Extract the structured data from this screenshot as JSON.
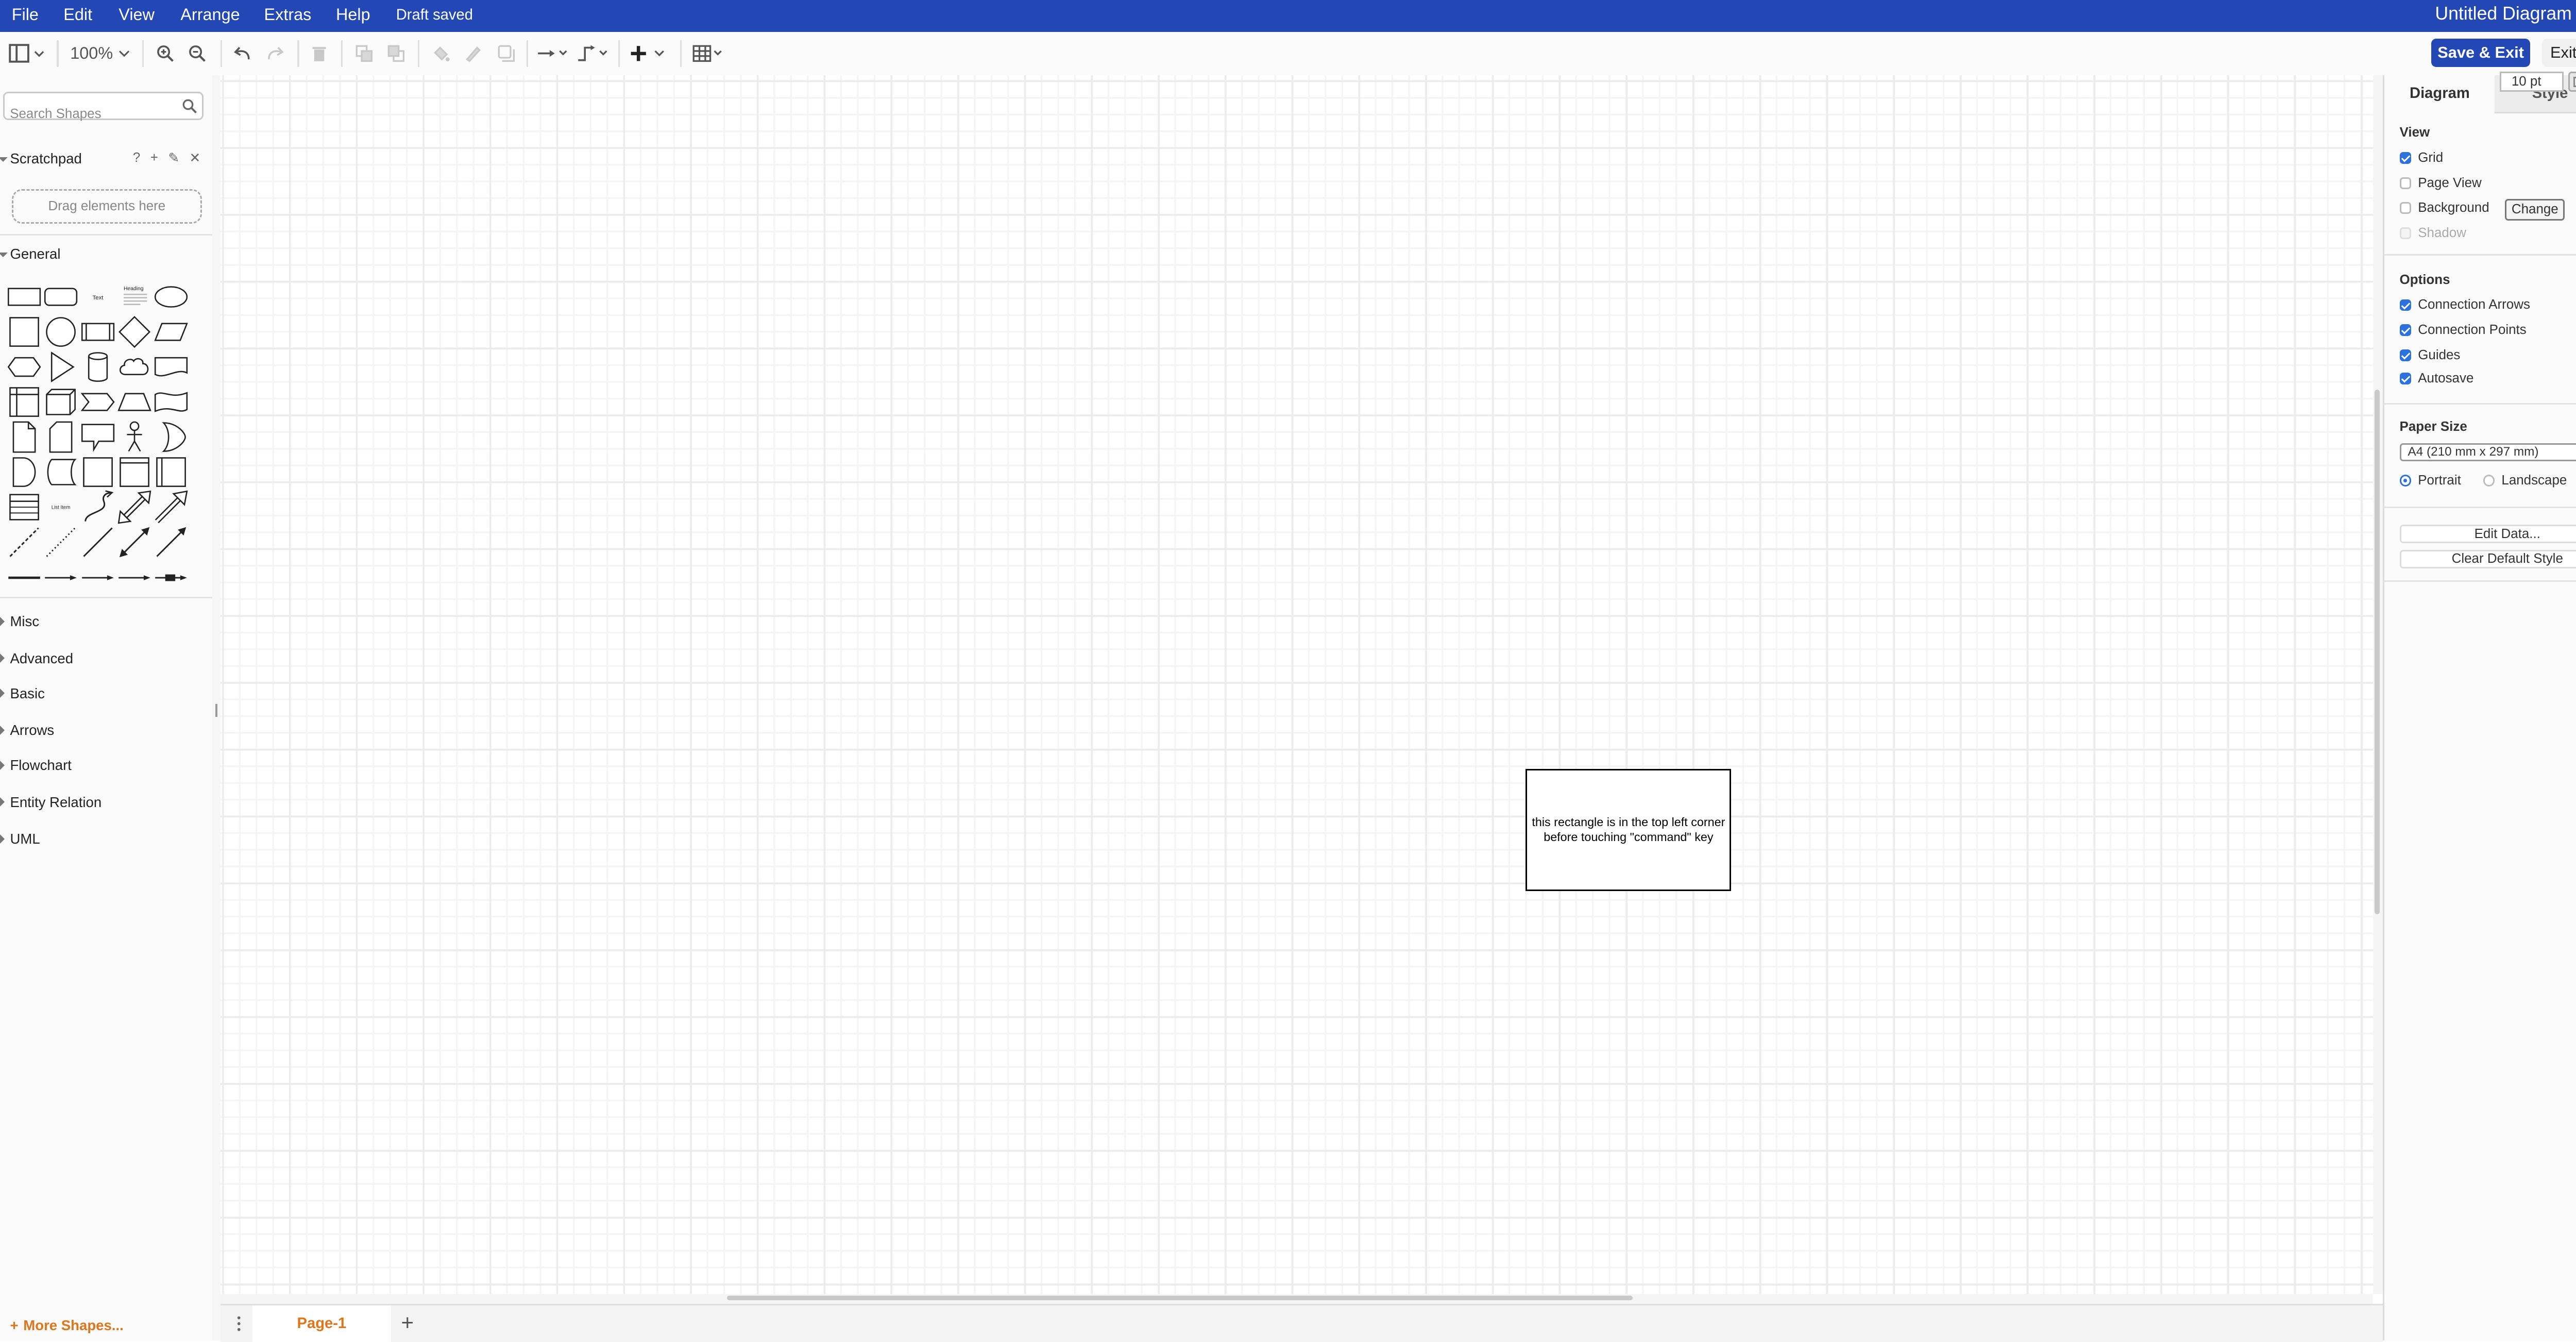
{
  "menubar": {
    "items": [
      "File",
      "Edit",
      "View",
      "Arrange",
      "Extras",
      "Help"
    ],
    "status": "Draft saved",
    "title": "Untitled Diagram"
  },
  "toolbar": {
    "zoom": "100%",
    "save_exit": "Save & Exit",
    "exit": "Exit"
  },
  "sidebar": {
    "search_placeholder": "Search Shapes",
    "scratchpad": {
      "label": "Scratchpad",
      "tools": [
        "?",
        "+",
        "✎",
        "✕"
      ],
      "dropzone": "Drag elements here"
    },
    "general_label": "General",
    "sections": [
      "Misc",
      "Advanced",
      "Basic",
      "Arrows",
      "Flowchart",
      "Entity Relation",
      "UML"
    ],
    "more_shapes": "More Shapes...",
    "shape_text_labels": {
      "text": "Text",
      "heading": "Heading",
      "list": "List Item"
    }
  },
  "canvas": {
    "rectangle_text": "this rectangle is in the top left corner before touching \"command\" key"
  },
  "pages": {
    "tabs": [
      "Page-1"
    ],
    "add": "+"
  },
  "panel": {
    "tabs": [
      "Diagram",
      "Style"
    ],
    "close": "✕",
    "view": {
      "heading": "View",
      "grid": {
        "label": "Grid",
        "checked": true,
        "size": "10 pt"
      },
      "page_view": {
        "label": "Page View",
        "checked": false
      },
      "background": {
        "label": "Background",
        "checked": false,
        "button": "Change"
      },
      "shadow": {
        "label": "Shadow",
        "checked": false,
        "disabled": true
      }
    },
    "options": {
      "heading": "Options",
      "items": [
        {
          "label": "Connection Arrows",
          "checked": true
        },
        {
          "label": "Connection Points",
          "checked": true
        },
        {
          "label": "Guides",
          "checked": true
        },
        {
          "label": "Autosave",
          "checked": true
        }
      ]
    },
    "paper": {
      "heading": "Paper Size",
      "selected": "A4 (210 mm x 297 mm)",
      "portrait": "Portrait",
      "landscape": "Landscape",
      "orientation": "Portrait"
    },
    "buttons": {
      "edit_data": "Edit Data...",
      "clear_style": "Clear Default Style"
    }
  },
  "colors": {
    "brand": "#2447b6",
    "accent": "#e0761c",
    "checkbox": "#2c72de"
  }
}
